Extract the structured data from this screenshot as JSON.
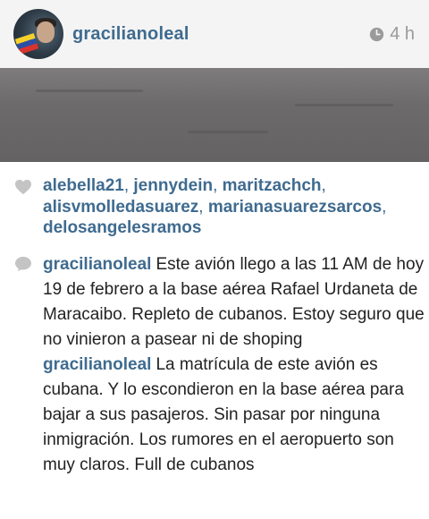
{
  "post": {
    "username": "gracilianoleal",
    "time_ago": "4 h"
  },
  "likes": {
    "users": [
      "alebella21",
      "jennydein",
      "maritzachch",
      "alisvmolledasuarez",
      "marianasuarezsarcos",
      "delosangelesramos"
    ]
  },
  "comments": [
    {
      "author": "gracilianoleal",
      "text": "Este avión llego a las 11 AM de hoy 19 de febrero a la base aérea Rafael Urdaneta de Maracaibo. Repleto de cubanos. Estoy seguro que no vinieron a pasear ni de shoping"
    },
    {
      "author": "gracilianoleal",
      "text": "La matrícula de este avión es cubana. Y lo escondieron en la base aérea para bajar a sus pasajeros. Sin pasar por ninguna inmigración. Los rumores en el aeropuerto son muy claros.  Full de cubanos"
    }
  ],
  "colors": {
    "username": "#3f6b8f",
    "meta": "#9a9a9a",
    "text": "#222222"
  }
}
